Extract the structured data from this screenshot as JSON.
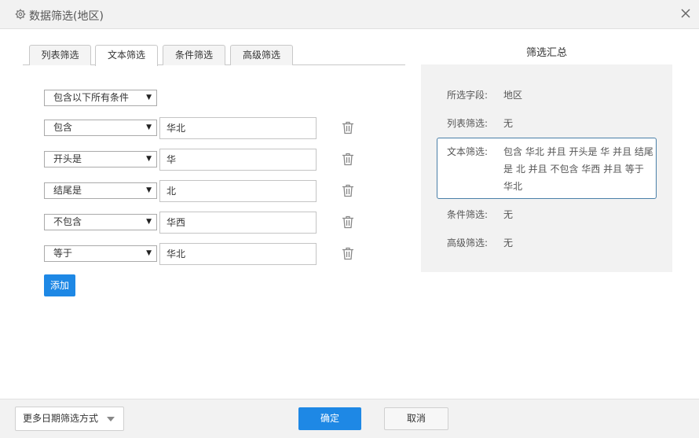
{
  "dialog": {
    "title": "数据筛选(地区)",
    "title_icon": "gear-icon",
    "close_icon": "close-icon"
  },
  "tabs": [
    {
      "label": "列表筛选",
      "active": false
    },
    {
      "label": "文本筛选",
      "active": true
    },
    {
      "label": "条件筛选",
      "active": false
    },
    {
      "label": "高级筛选",
      "active": false
    }
  ],
  "text_filter": {
    "match_mode": "包含以下所有条件",
    "conditions": [
      {
        "operator": "包含",
        "value": "华北"
      },
      {
        "operator": "开头是",
        "value": "华"
      },
      {
        "operator": "结尾是",
        "value": "北"
      },
      {
        "operator": "不包含",
        "value": "华西"
      },
      {
        "operator": "等于",
        "value": "华北"
      }
    ],
    "add_label": "添加"
  },
  "summary": {
    "title": "筛选汇总",
    "field_label": "所选字段:",
    "field_value": "地区",
    "list_label": "列表筛选:",
    "list_value": "无",
    "text_label": "文本筛选:",
    "text_value": "包含 华北 并且 开头是 华 并且 结尾是 北 并且 不包含 华西 并且 等于 华北",
    "condition_label": "条件筛选:",
    "condition_value": "无",
    "advanced_label": "高级筛选:",
    "advanced_value": "无"
  },
  "footer": {
    "date_filter_label": "更多日期筛选方式",
    "ok_label": "确定",
    "cancel_label": "取消"
  },
  "colors": {
    "primary": "#1e88e5",
    "summary_border": "#4a7fa8",
    "panel_bg": "#f2f2f2"
  }
}
